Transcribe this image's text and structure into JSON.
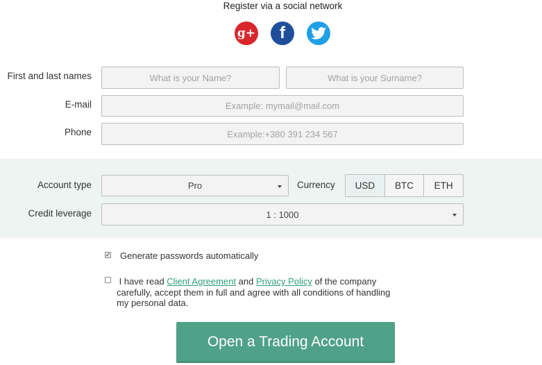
{
  "social": {
    "title": "Register via a social network",
    "google_glyph": "g+",
    "facebook_glyph": "f",
    "icons": [
      "google-plus-icon",
      "facebook-icon",
      "twitter-icon"
    ],
    "colors": {
      "google": "#d8262c",
      "facebook": "#1f4f9a",
      "twitter": "#22a0e6"
    }
  },
  "form": {
    "name_label": "First and last names",
    "first_name_placeholder": "What is your Name?",
    "last_name_placeholder": "What is your Surname?",
    "email_label": "E-mail",
    "email_placeholder": "Example: mymail@mail.com",
    "phone_label": "Phone",
    "phone_placeholder": "Example:+380 391 234 567"
  },
  "account": {
    "type_label": "Account type",
    "type_value": "Pro",
    "currency_label": "Currency",
    "currencies": [
      "USD",
      "BTC",
      "ETH"
    ],
    "selected_currency": "USD",
    "leverage_label": "Credit leverage",
    "leverage_value": "1 : 1000"
  },
  "options": {
    "generate_passwords_label": "Generate passwords automatically",
    "generate_passwords_checked": true,
    "agree_checked": false,
    "agree_text_1": "I have read ",
    "client_agreement_link": "Client Agreement",
    "agree_text_2": " and ",
    "privacy_policy_link": "Privacy Policy",
    "agree_text_3": " of the company carefully, accept them in full and agree with all conditions of handling my personal data."
  },
  "cta": {
    "label": "Open a Trading Account",
    "color": "#4fa188"
  }
}
